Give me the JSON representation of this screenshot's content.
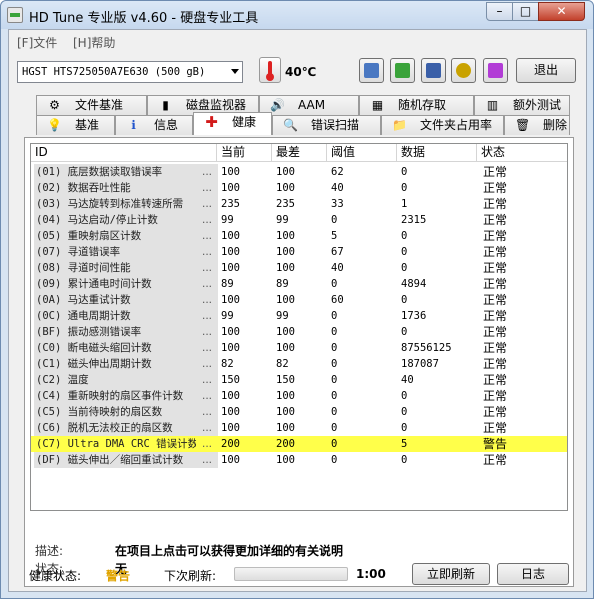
{
  "window": {
    "title": "HD Tune 专业版 v4.60 - 硬盘专业工具",
    "min_glyph": "–",
    "max_glyph": "□",
    "close_glyph": "✕"
  },
  "menu": [
    {
      "label": "[F]文件"
    },
    {
      "label": "[H]帮助"
    }
  ],
  "toolbar": {
    "drive": "HGST HTS725050A7E630 (500 gB)",
    "temperature": "40℃",
    "exit_label": "退出",
    "tool_icons": [
      "copy-info-icon",
      "copy-screen-icon",
      "save-icon",
      "options-icon",
      "download-icon"
    ],
    "tool_colors": [
      "#4a78c2",
      "#3aa33a",
      "#3a5fa8",
      "#c9a200",
      "#b23cd6"
    ]
  },
  "tabs_top": [
    {
      "label": "文件基准",
      "icon": "file-benchmark-icon",
      "glyph": "⚙"
    },
    {
      "label": "磁盘监视器",
      "icon": "disk-monitor-icon",
      "glyph": "▮"
    },
    {
      "label": "AAM",
      "icon": "speaker-icon",
      "glyph": "🔊"
    },
    {
      "label": "随机存取",
      "icon": "random-access-icon",
      "glyph": "▦"
    },
    {
      "label": "额外测试",
      "icon": "extra-tests-icon",
      "glyph": "▥"
    }
  ],
  "tabs_bottom": [
    {
      "label": "基准",
      "icon": "benchmark-icon",
      "glyph": "💡"
    },
    {
      "label": "信息",
      "icon": "info-icon",
      "glyph": "ℹ"
    },
    {
      "label": "健康",
      "icon": "health-cross-icon",
      "glyph": "✚"
    },
    {
      "label": "错误扫描",
      "icon": "error-scan-icon",
      "glyph": "🔍"
    },
    {
      "label": "文件夹占用率",
      "icon": "folder-usage-icon",
      "glyph": "📁"
    },
    {
      "label": "删除",
      "icon": "erase-icon",
      "glyph": "🗑"
    }
  ],
  "table": {
    "headers": [
      "ID",
      "当前",
      "最差",
      "阈值",
      "数据",
      "状态"
    ],
    "rows": [
      {
        "id": "(01) 底层数据读取错误率",
        "current": "100",
        "worst": "100",
        "threshold": "62",
        "data": "0",
        "status": "正常"
      },
      {
        "id": "(02) 数据吞吐性能",
        "current": "100",
        "worst": "100",
        "threshold": "40",
        "data": "0",
        "status": "正常"
      },
      {
        "id": "(03) 马达旋转到标准转速所需",
        "current": "235",
        "worst": "235",
        "threshold": "33",
        "data": "1",
        "status": "正常"
      },
      {
        "id": "(04) 马达启动/停止计数",
        "current": "99",
        "worst": "99",
        "threshold": "0",
        "data": "2315",
        "status": "正常"
      },
      {
        "id": "(05) 重映射扇区计数",
        "current": "100",
        "worst": "100",
        "threshold": "5",
        "data": "0",
        "status": "正常"
      },
      {
        "id": "(07) 寻道错误率",
        "current": "100",
        "worst": "100",
        "threshold": "67",
        "data": "0",
        "status": "正常"
      },
      {
        "id": "(08) 寻道时间性能",
        "current": "100",
        "worst": "100",
        "threshold": "40",
        "data": "0",
        "status": "正常"
      },
      {
        "id": "(09) 累计通电时间计数",
        "current": "89",
        "worst": "89",
        "threshold": "0",
        "data": "4894",
        "status": "正常"
      },
      {
        "id": "(0A) 马达重试计数",
        "current": "100",
        "worst": "100",
        "threshold": "60",
        "data": "0",
        "status": "正常"
      },
      {
        "id": "(0C) 通电周期计数",
        "current": "99",
        "worst": "99",
        "threshold": "0",
        "data": "1736",
        "status": "正常"
      },
      {
        "id": "(BF) 振动感测错误率",
        "current": "100",
        "worst": "100",
        "threshold": "0",
        "data": "0",
        "status": "正常"
      },
      {
        "id": "(C0) 断电磁头缩回计数",
        "current": "100",
        "worst": "100",
        "threshold": "0",
        "data": "87556125",
        "status": "正常"
      },
      {
        "id": "(C1) 磁头伸出周期计数",
        "current": "82",
        "worst": "82",
        "threshold": "0",
        "data": "187087",
        "status": "正常"
      },
      {
        "id": "(C2) 温度",
        "current": "150",
        "worst": "150",
        "threshold": "0",
        "data": "40",
        "status": "正常"
      },
      {
        "id": "(C4) 重新映射的扇区事件计数",
        "current": "100",
        "worst": "100",
        "threshold": "0",
        "data": "0",
        "status": "正常"
      },
      {
        "id": "(C5) 当前待映射的扇区数",
        "current": "100",
        "worst": "100",
        "threshold": "0",
        "data": "0",
        "status": "正常"
      },
      {
        "id": "(C6) 脱机无法校正的扇区数",
        "current": "100",
        "worst": "100",
        "threshold": "0",
        "data": "0",
        "status": "正常"
      },
      {
        "id": "(C7) Ultra DMA CRC 错误计数",
        "current": "200",
        "worst": "200",
        "threshold": "0",
        "data": "5",
        "status": "警告",
        "warn": true
      },
      {
        "id": "(DF) 磁头伸出／缩回重试计数",
        "current": "100",
        "worst": "100",
        "threshold": "0",
        "data": "0",
        "status": "正常"
      }
    ],
    "ellipsis": "..."
  },
  "description": {
    "desc_label": "描述:",
    "desc_value": "在项目上点击可以获得更加详细的有关说明",
    "status_label": "状态:",
    "status_value": "无"
  },
  "footer": {
    "health_label": "健康状态:",
    "health_value": "警告",
    "health_color": "#e0a400",
    "next_refresh_label": "下次刷新:",
    "refresh_progress_fraction": 0,
    "timer": "1:00",
    "refresh_now_label": "立即刷新",
    "log_label": "日志"
  }
}
